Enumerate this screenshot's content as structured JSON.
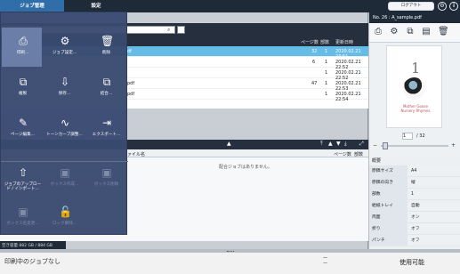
{
  "tabs": [
    {
      "label": "ジョブ管理"
    },
    {
      "label": "設定"
    }
  ],
  "header": {
    "logout_label": "ログアウト",
    "account_icon": "user-settings-icon",
    "info_icon": "info-icon"
  },
  "top_list": {
    "search_placeholder": "",
    "columns": [
      "ページ数",
      "部数",
      "更新日時"
    ],
    "rows": [
      {
        "name": "df",
        "pages": "32",
        "copies": "1",
        "date": "2020.02.21 23:51",
        "selected": true
      },
      {
        "name": "",
        "pages": "6",
        "copies": "1",
        "date": "2020.02.21 22:52",
        "selected": false
      },
      {
        "name": "",
        "pages": "",
        "copies": "1",
        "date": "2020.02.21 22:52",
        "selected": false
      },
      {
        "name": "pdf",
        "pages": "47",
        "copies": "1",
        "date": "2020.02.21 22:53",
        "selected": false
      },
      {
        "name": "pdf",
        "pages": "",
        "copies": "1",
        "date": "2020.02.21 22:54",
        "selected": false
      }
    ]
  },
  "menu": {
    "items": [
      {
        "label": "印刷...",
        "icon": "print-icon",
        "disabled": false
      },
      {
        "label": "ジョブ設定...",
        "icon": "job-settings-icon",
        "disabled": false
      },
      {
        "label": "削除",
        "icon": "trash-icon",
        "disabled": false
      },
      {
        "label": "複製",
        "icon": "duplicate-icon",
        "disabled": false
      },
      {
        "label": "保存...",
        "icon": "download-icon",
        "disabled": false
      },
      {
        "label": "結合...",
        "icon": "merge-icon",
        "disabled": false
      },
      {
        "label": "ページ編集...",
        "icon": "page-edit-icon",
        "disabled": false
      },
      {
        "label": "トーンカーブ調整...",
        "icon": "tone-curve-icon",
        "disabled": false
      },
      {
        "label": "エクスポート...",
        "icon": "export-icon",
        "disabled": false
      },
      {
        "label": "ジョブのアップロード / インポート...",
        "icon": "upload-import-icon",
        "disabled": false
      },
      {
        "label": "ボックス作成...",
        "icon": "box-create-icon",
        "disabled": true
      },
      {
        "label": "ボックス削除",
        "icon": "box-delete-icon",
        "disabled": true
      },
      {
        "label": "ボックス名変更...",
        "icon": "box-rename-icon",
        "disabled": true
      },
      {
        "label": "ロック解除...",
        "icon": "unlock-icon",
        "disabled": true
      }
    ]
  },
  "lower_list": {
    "columns": [
      "ァイル名",
      "ページ数",
      "部数"
    ],
    "empty_message": "配合ジョブはありません。"
  },
  "disk": {
    "label": "空き容量 882 GB / 884 GB"
  },
  "preview": {
    "title": "No. 26 : A_sample.pdf",
    "page_indicator": "/ 32",
    "page_value": "1",
    "preview_number": "1",
    "preview_text": "Mother Goose Nursery Rhymes"
  },
  "properties": {
    "heading": "概要",
    "rows": [
      {
        "name": "原稿サイズ",
        "value": "A4"
      },
      {
        "name": "原稿の向き",
        "value": "縦"
      },
      {
        "name": "部数",
        "value": "1"
      },
      {
        "name": "給紙トレイ",
        "value": "自動"
      },
      {
        "name": "両面",
        "value": "オン"
      },
      {
        "name": "折り",
        "value": "オフ"
      },
      {
        "name": "パンチ",
        "value": "オフ"
      }
    ]
  },
  "status": {
    "left": "印刷中のジョブなし",
    "right": "使用可能"
  },
  "colors": {
    "dark": "#1f2a38",
    "menu": "#394a70",
    "selected": "#65bce6",
    "active_tab": "#2f6ea8"
  }
}
